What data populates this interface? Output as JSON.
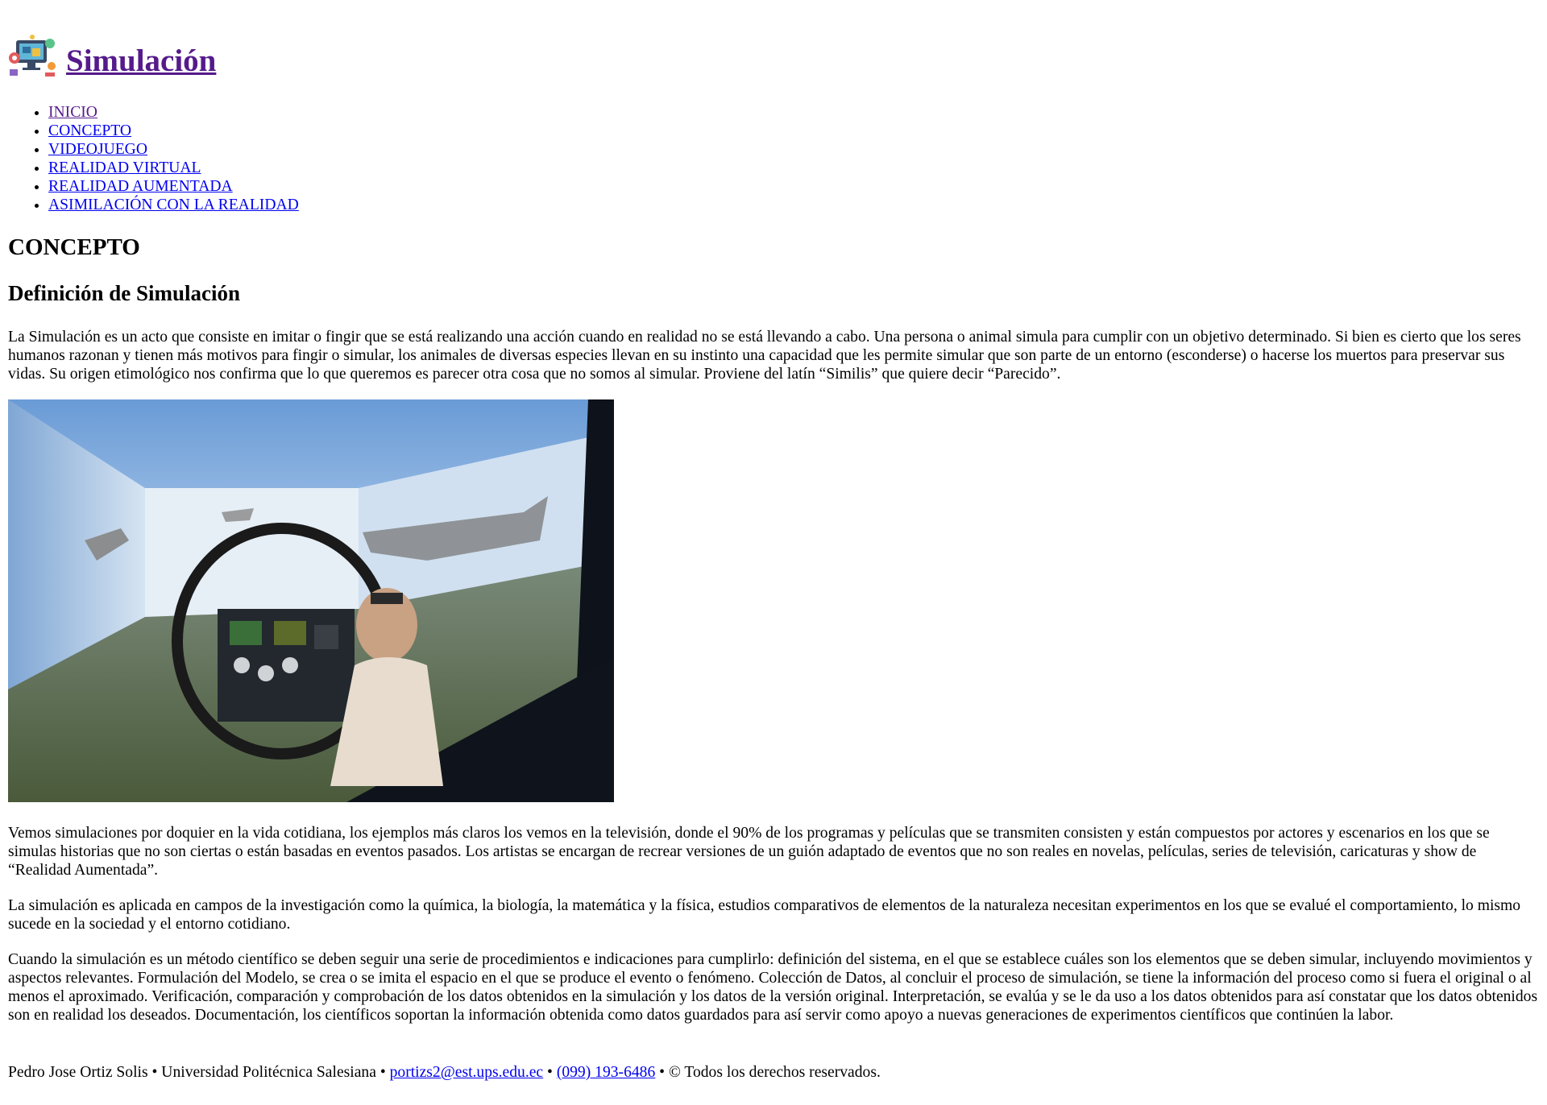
{
  "header": {
    "logo_icon": "simulation-logo-icon",
    "title": "Simulación"
  },
  "nav": {
    "items": [
      {
        "label": "INICIO",
        "visited": true
      },
      {
        "label": "CONCEPTO"
      },
      {
        "label": "VIDEOJUEGO"
      },
      {
        "label": "REALIDAD VIRTUAL"
      },
      {
        "label": "REALIDAD AUMENTADA"
      },
      {
        "label": "ASIMILACIÓN CON LA REALIDAD"
      }
    ]
  },
  "main": {
    "section_title": "CONCEPTO",
    "subtitle": "Definición de Simulación",
    "paragraphs": [
      "La Simulación es un acto que consiste en imitar o fingir que se está realizando una acción cuando en realidad no se está llevando a cabo. Una persona o animal simula para cumplir con un objetivo determinado. Si bien es cierto que los seres humanos razonan y tienen más motivos para fingir o simular, los animales de diversas especies llevan en su instinto una capacidad que les permite simular que son parte de un entorno (esconderse) o hacerse los muertos para preservar sus vidas. Su origen etimológico nos confirma que lo que queremos es parecer otra cosa que no somos al simular. Proviene del latín “Similis” que quiere decir “Parecido”.",
      "Vemos simulaciones por doquier en la vida cotidiana, los ejemplos más claros los vemos en la televisión, donde el 90% de los programas y películas que se transmiten consisten y están compuestos por actores y escenarios en los que se simulas historias que no son ciertas o están basadas en eventos pasados. Los artistas se encargan de recrear versiones de un guión adaptado de eventos que no son reales en novelas, películas, series de televisión, caricaturas y show de “Realidad Aumentada”.",
      "La simulación es aplicada en campos de la investigación como la química, la biología, la matemática y la física, estudios comparativos de elementos de la naturaleza necesitan experimentos en los que se evalué el comportamiento, lo mismo sucede en la sociedad y el entorno cotidiano.",
      "Cuando la simulación es un método científico se deben seguir una serie de procedimientos e indicaciones para cumplirlo: definición del sistema, en el que se establece cuáles son los elementos que se deben simular, incluyendo movimientos y aspectos relevantes. Formulación del Modelo, se crea o se imita el espacio en el que se produce el evento o fenómeno. Colección de Datos, al concluir el proceso de simulación, se tiene la información del proceso como si fuera el original o al menos el aproximado. Verificación, comparación y comprobación de los datos obtenidos en la simulación y los datos de la versión original. Interpretación, se evalúa y se le da uso a los datos obtenidos para así constatar que los datos obtenidos son en realidad los deseados. Documentación, los científicos soportan la información obtenida como datos guardados para así servir como apoyo a nuevas generaciones de experimentos científicos que continúen la labor."
    ],
    "image_icon": "flight-simulator-photo"
  },
  "footer": {
    "author": "Pedro Jose Ortiz Solis",
    "sep": " • ",
    "university": "Universidad Politécnica Salesiana",
    "email": "portizs2@est.ups.edu.ec",
    "phone": "(099) 193-6486",
    "rights": "© Todos los derechos reservados."
  }
}
